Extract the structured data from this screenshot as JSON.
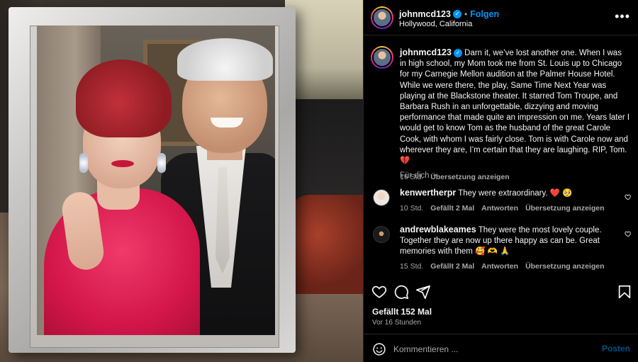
{
  "header": {
    "username": "johnmcd123",
    "verified": true,
    "separator": "•",
    "follow_label": "Folgen",
    "location": "Hollywood, California",
    "more_icon": "more-options-icon"
  },
  "caption": {
    "username": "johnmcd123",
    "text": "Darn it, we’ve lost another one. When I was in high school, my Mom took me from St. Louis up to Chicago for my Carnegie Mellon audition at the Palmer House Hotel. While we were there, the play, Same Time Next Year was playing at the Blackstone theater. It starred Tom Troupe, and Barbara Rush in an unforgettable, dizzying and moving performance that made quite an impression on me. Years later I would get to know Tom as the husband of the great Carole Cook, with whom I was fairly close. Tom is with Carole now and wherever they are, I’m certain that they are laughing. RIP, Tom. 💔",
    "time": "16 Std.",
    "translate": "Übersetzung anzeigen"
  },
  "for_you": {
    "label": "Für dich",
    "chevron": "⌄"
  },
  "comments": [
    {
      "username": "kenwertherpr",
      "text": "They were extraordinary. ❤️ 🥺",
      "time": "10 Std.",
      "likes": "Gefällt 2 Mal",
      "reply": "Antworten",
      "translate": "Übersetzung anzeigen"
    },
    {
      "username": "andrewblakeames",
      "text": "They were the most lovely couple. Together they are now up there happy as can be. Great memories with them 🥰 🫶 🙏",
      "time": "15 Std.",
      "likes": "Gefällt 2 Mal",
      "reply": "Antworten",
      "translate": "Übersetzung anzeigen"
    }
  ],
  "actions": {
    "like_icon": "heart-icon",
    "comment_icon": "comment-icon",
    "share_icon": "share-icon",
    "save_icon": "bookmark-icon"
  },
  "stats": {
    "likes": "Gefällt 152 Mal",
    "time_ago": "Vor 16 Stunden"
  },
  "comment_box": {
    "placeholder": "Kommentieren ...",
    "post_label": "Posten",
    "emoji_icon": "emoji-icon"
  },
  "colors": {
    "background": "#000000",
    "accent": "#0095f6",
    "text": "#f5f5f5",
    "secondary_text": "#a8a8a8",
    "divider": "#262626"
  }
}
